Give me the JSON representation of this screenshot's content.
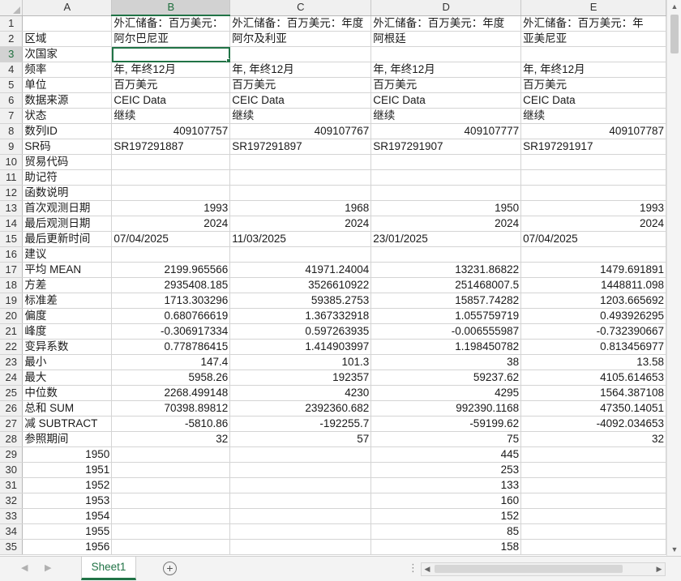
{
  "columns": [
    "A",
    "B",
    "C",
    "D",
    "E"
  ],
  "selected_cell": {
    "column": "B",
    "row": 3
  },
  "rows": [
    {
      "n": "1",
      "a": "",
      "b": "外汇储备：百万美元：",
      "c": "外汇储备：百万美元：年度",
      "d": "外汇储备：百万美元：年度",
      "e": "外汇储备：百万美元：年"
    },
    {
      "n": "2",
      "a": "区域",
      "b": "阿尔巴尼亚",
      "c": "阿尔及利亚",
      "d": "阿根廷",
      "e": "亚美尼亚"
    },
    {
      "n": "3",
      "a": "次国家",
      "b": "",
      "c": "",
      "d": "",
      "e": ""
    },
    {
      "n": "4",
      "a": "频率",
      "b": "年, 年终12月",
      "c": "年, 年终12月",
      "d": "年, 年终12月",
      "e": "年, 年终12月"
    },
    {
      "n": "5",
      "a": "单位",
      "b": "百万美元",
      "c": "百万美元",
      "d": "百万美元",
      "e": "百万美元"
    },
    {
      "n": "6",
      "a": "数据来源",
      "b": "CEIC Data",
      "c": "CEIC Data",
      "d": "CEIC Data",
      "e": "CEIC Data"
    },
    {
      "n": "7",
      "a": "状态",
      "b": "继续",
      "c": "继续",
      "d": "继续",
      "e": "继续"
    },
    {
      "n": "8",
      "a": "数列ID",
      "b": "409107757",
      "c": "409107767",
      "d": "409107777",
      "e": "409107787"
    },
    {
      "n": "9",
      "a": "SR码",
      "b": "SR197291887",
      "c": "SR197291897",
      "d": "SR197291907",
      "e": "SR197291917"
    },
    {
      "n": "10",
      "a": "贸易代码",
      "b": "",
      "c": "",
      "d": "",
      "e": ""
    },
    {
      "n": "11",
      "a": "助记符",
      "b": "",
      "c": "",
      "d": "",
      "e": ""
    },
    {
      "n": "12",
      "a": "函数说明",
      "b": "",
      "c": "",
      "d": "",
      "e": ""
    },
    {
      "n": "13",
      "a": "首次观测日期",
      "b": "1993",
      "c": "1968",
      "d": "1950",
      "e": "1993"
    },
    {
      "n": "14",
      "a": "最后观测日期",
      "b": "2024",
      "c": "2024",
      "d": "2024",
      "e": "2024"
    },
    {
      "n": "15",
      "a": "最后更新时间",
      "b": "07/04/2025",
      "c": "11/03/2025",
      "d": "23/01/2025",
      "e": "07/04/2025"
    },
    {
      "n": "16",
      "a": "建议",
      "b": "",
      "c": "",
      "d": "",
      "e": ""
    },
    {
      "n": "17",
      "a": "平均 MEAN",
      "b": "2199.965566",
      "c": "41971.24004",
      "d": "13231.86822",
      "e": "1479.691891"
    },
    {
      "n": "18",
      "a": "方差",
      "b": "2935408.185",
      "c": "3526610922",
      "d": "251468007.5",
      "e": "1448811.098"
    },
    {
      "n": "19",
      "a": "标准差",
      "b": "1713.303296",
      "c": "59385.2753",
      "d": "15857.74282",
      "e": "1203.665692"
    },
    {
      "n": "20",
      "a": "偏度",
      "b": "0.680766619",
      "c": "1.367332918",
      "d": "1.055759719",
      "e": "0.493926295"
    },
    {
      "n": "21",
      "a": "峰度",
      "b": "-0.306917334",
      "c": "0.597263935",
      "d": "-0.006555987",
      "e": "-0.732390667"
    },
    {
      "n": "22",
      "a": "变异系数",
      "b": "0.778786415",
      "c": "1.414903997",
      "d": "1.198450782",
      "e": "0.813456977"
    },
    {
      "n": "23",
      "a": "最小",
      "b": "147.4",
      "c": "101.3",
      "d": "38",
      "e": "13.58"
    },
    {
      "n": "24",
      "a": "最大",
      "b": "5958.26",
      "c": "192357",
      "d": "59237.62",
      "e": "4105.614653"
    },
    {
      "n": "25",
      "a": "中位数",
      "b": "2268.499148",
      "c": "4230",
      "d": "4295",
      "e": "1564.387108"
    },
    {
      "n": "26",
      "a": "总和 SUM",
      "b": "70398.89812",
      "c": "2392360.682",
      "d": "992390.1168",
      "e": "47350.14051"
    },
    {
      "n": "27",
      "a": "减 SUBTRACT",
      "b": "-5810.86",
      "c": "-192255.7",
      "d": "-59199.62",
      "e": "-4092.034653"
    },
    {
      "n": "28",
      "a": "参照期间",
      "b": "32",
      "c": "57",
      "d": "75",
      "e": "32"
    },
    {
      "n": "29",
      "a": "1950",
      "b": "",
      "c": "",
      "d": "445",
      "e": ""
    },
    {
      "n": "30",
      "a": "1951",
      "b": "",
      "c": "",
      "d": "253",
      "e": ""
    },
    {
      "n": "31",
      "a": "1952",
      "b": "",
      "c": "",
      "d": "133",
      "e": ""
    },
    {
      "n": "32",
      "a": "1953",
      "b": "",
      "c": "",
      "d": "160",
      "e": ""
    },
    {
      "n": "33",
      "a": "1954",
      "b": "",
      "c": "",
      "d": "152",
      "e": ""
    },
    {
      "n": "34",
      "a": "1955",
      "b": "",
      "c": "",
      "d": "85",
      "e": ""
    },
    {
      "n": "35",
      "a": "1956",
      "b": "",
      "c": "",
      "d": "158",
      "e": ""
    }
  ],
  "numeric_rows": [
    "8",
    "13",
    "14",
    "17",
    "18",
    "19",
    "20",
    "21",
    "22",
    "23",
    "24",
    "25",
    "26",
    "27",
    "28",
    "29",
    "30",
    "31",
    "32",
    "33",
    "34",
    "35"
  ],
  "sheet_tab": "Sheet1",
  "add_sheet_symbol": "+",
  "icons": {
    "scroll_up": "up-arrow-icon",
    "scroll_down": "down-arrow-icon",
    "scroll_left": "left-arrow-icon",
    "scroll_right": "right-arrow-icon",
    "add_sheet": "plus-circle-icon"
  },
  "colors": {
    "accent": "#217346",
    "grid": "#d4d4d4",
    "header_bg": "#f0f0f0"
  }
}
